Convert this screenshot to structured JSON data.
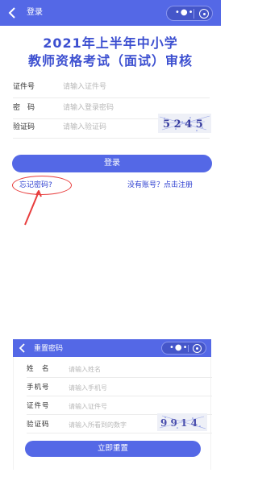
{
  "login": {
    "nav_title": "登录",
    "heading_line1": "2021年上半年中小学",
    "heading_line2": "教师资格考试（面试）审核",
    "fields": [
      {
        "label": "证件号",
        "placeholder": "请输入证件号"
      },
      {
        "label": "密　码",
        "placeholder": "请输入登录密码"
      },
      {
        "label": "验证码",
        "placeholder": "请输入验证码"
      }
    ],
    "captcha_text": "5 2 4 5",
    "submit_label": "登录",
    "forgot_link": "忘记密码?",
    "register_link": "没有账号？点击注册"
  },
  "reset": {
    "nav_title": "重置密码",
    "fields": [
      {
        "label": "姓　名",
        "placeholder": "请输入姓名"
      },
      {
        "label": "手机号",
        "placeholder": "请输入手机号"
      },
      {
        "label": "证件号",
        "placeholder": "请输入证件号"
      },
      {
        "label": "验证码",
        "placeholder": "请输入所看到的数字"
      }
    ],
    "captcha_text": "9 9 1 4",
    "submit_label": "立即重置"
  },
  "colors": {
    "brand": "#5468e6",
    "heading": "#3c4fd0",
    "link": "#2d3fd0",
    "annotation": "#e83c3c"
  },
  "icons": [
    "back-arrow-icon",
    "more-dots-icon",
    "close-target-icon",
    "annotation-arrow-icon"
  ]
}
